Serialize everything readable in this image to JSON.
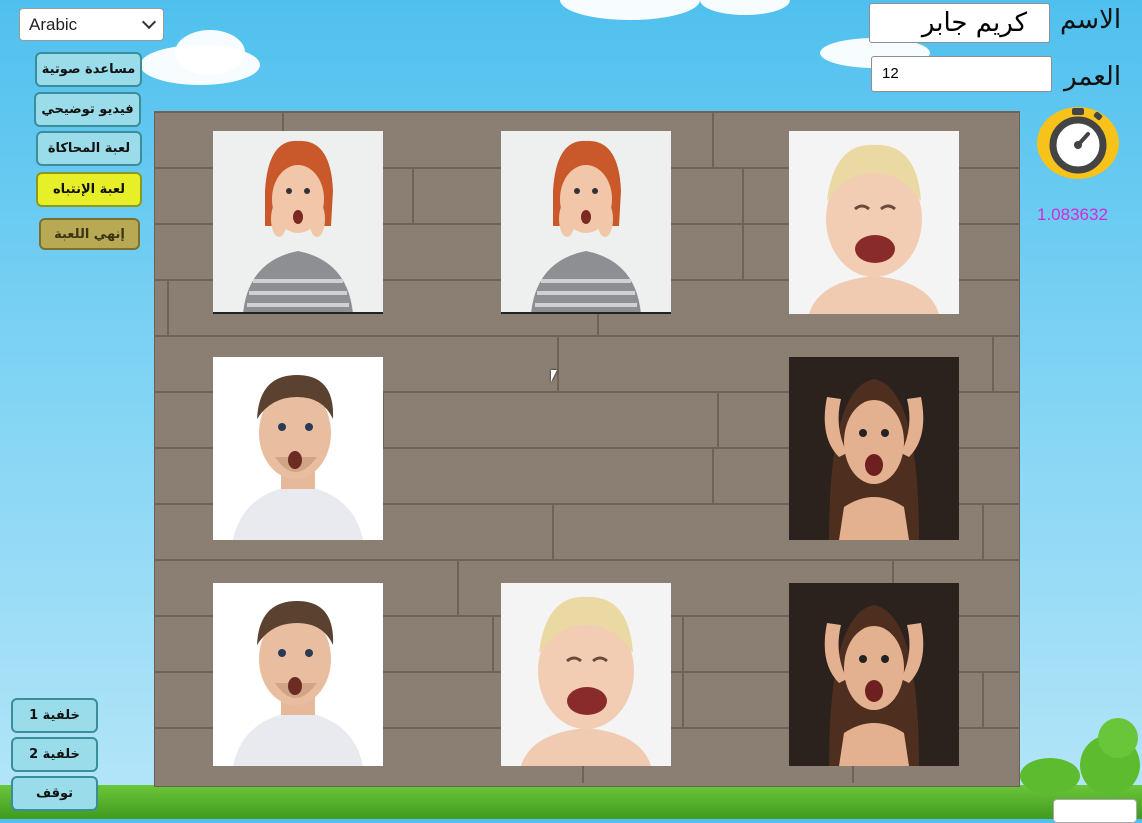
{
  "language_select": {
    "value": "Arabic"
  },
  "sidebar": {
    "buttons": [
      {
        "label": "مساعدة صوتية"
      },
      {
        "label": "فيديو توضيحي"
      },
      {
        "label": "لعبة المحاكاة"
      },
      {
        "label": "لعبة الإنتباه",
        "state": "active"
      },
      {
        "label": "إنهي اللعبة"
      }
    ]
  },
  "form": {
    "name_label": "الاسم",
    "name_value": "كريم جابر",
    "age_label": "العمر",
    "age_value": "12"
  },
  "timer": {
    "icon": "stopwatch-icon",
    "value": "1.083632"
  },
  "cards": [
    {
      "face": "surprised-woman"
    },
    {
      "face": "surprised-woman"
    },
    {
      "face": "crying-baby"
    },
    {
      "face": "surprised-man"
    },
    null,
    {
      "face": "screaming-woman"
    },
    {
      "face": "surprised-man"
    },
    {
      "face": "crying-baby"
    },
    {
      "face": "screaming-woman"
    }
  ],
  "background_buttons": [
    {
      "label": "خلفية 1"
    },
    {
      "label": "خلفية 2"
    },
    {
      "label": "توقف"
    }
  ],
  "colors": {
    "active_button": "#e6ef28",
    "button": "#9adcea",
    "timer_text": "#d42ad8"
  }
}
